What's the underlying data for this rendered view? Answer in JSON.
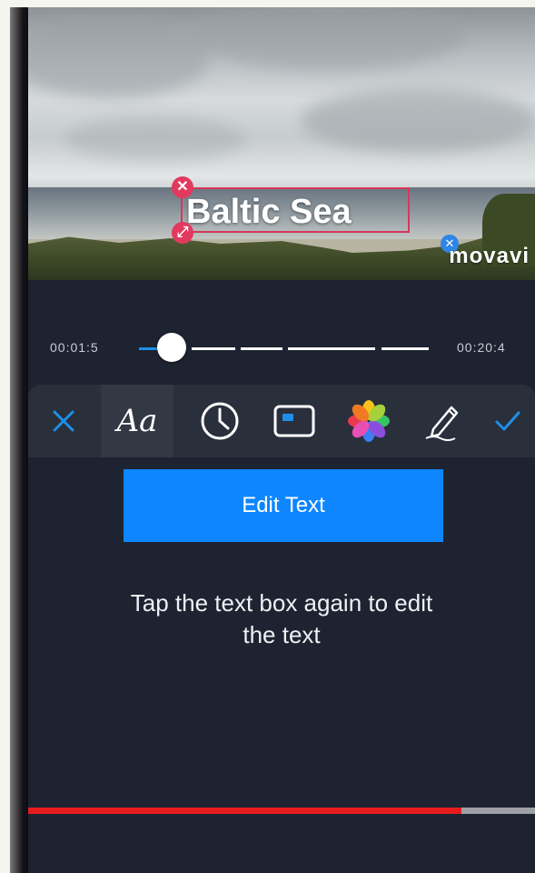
{
  "preview": {
    "overlay_text": "Baltic Sea",
    "watermark": "movavi",
    "delete_handle_icon": "close-icon",
    "resize_handle_icon": "resize-icon"
  },
  "timeline": {
    "current_time": "00:01:5",
    "total_time": "00:20:4"
  },
  "toolbar": {
    "tools": [
      "close-icon",
      "font-icon",
      "clock-icon",
      "text-box-style-icon",
      "color-palette-icon",
      "pen-icon",
      "checkmark-icon"
    ],
    "font_label": "Aa",
    "accent_color": "#1e8fe8"
  },
  "edit_button": {
    "label": "Edit Text",
    "color": "#0d86ff"
  },
  "hint": {
    "line1": "Tap the text box again to edit",
    "line2": "the text"
  },
  "video_progress": {
    "played_fraction": 0.86,
    "played_color": "#e61c1c"
  }
}
